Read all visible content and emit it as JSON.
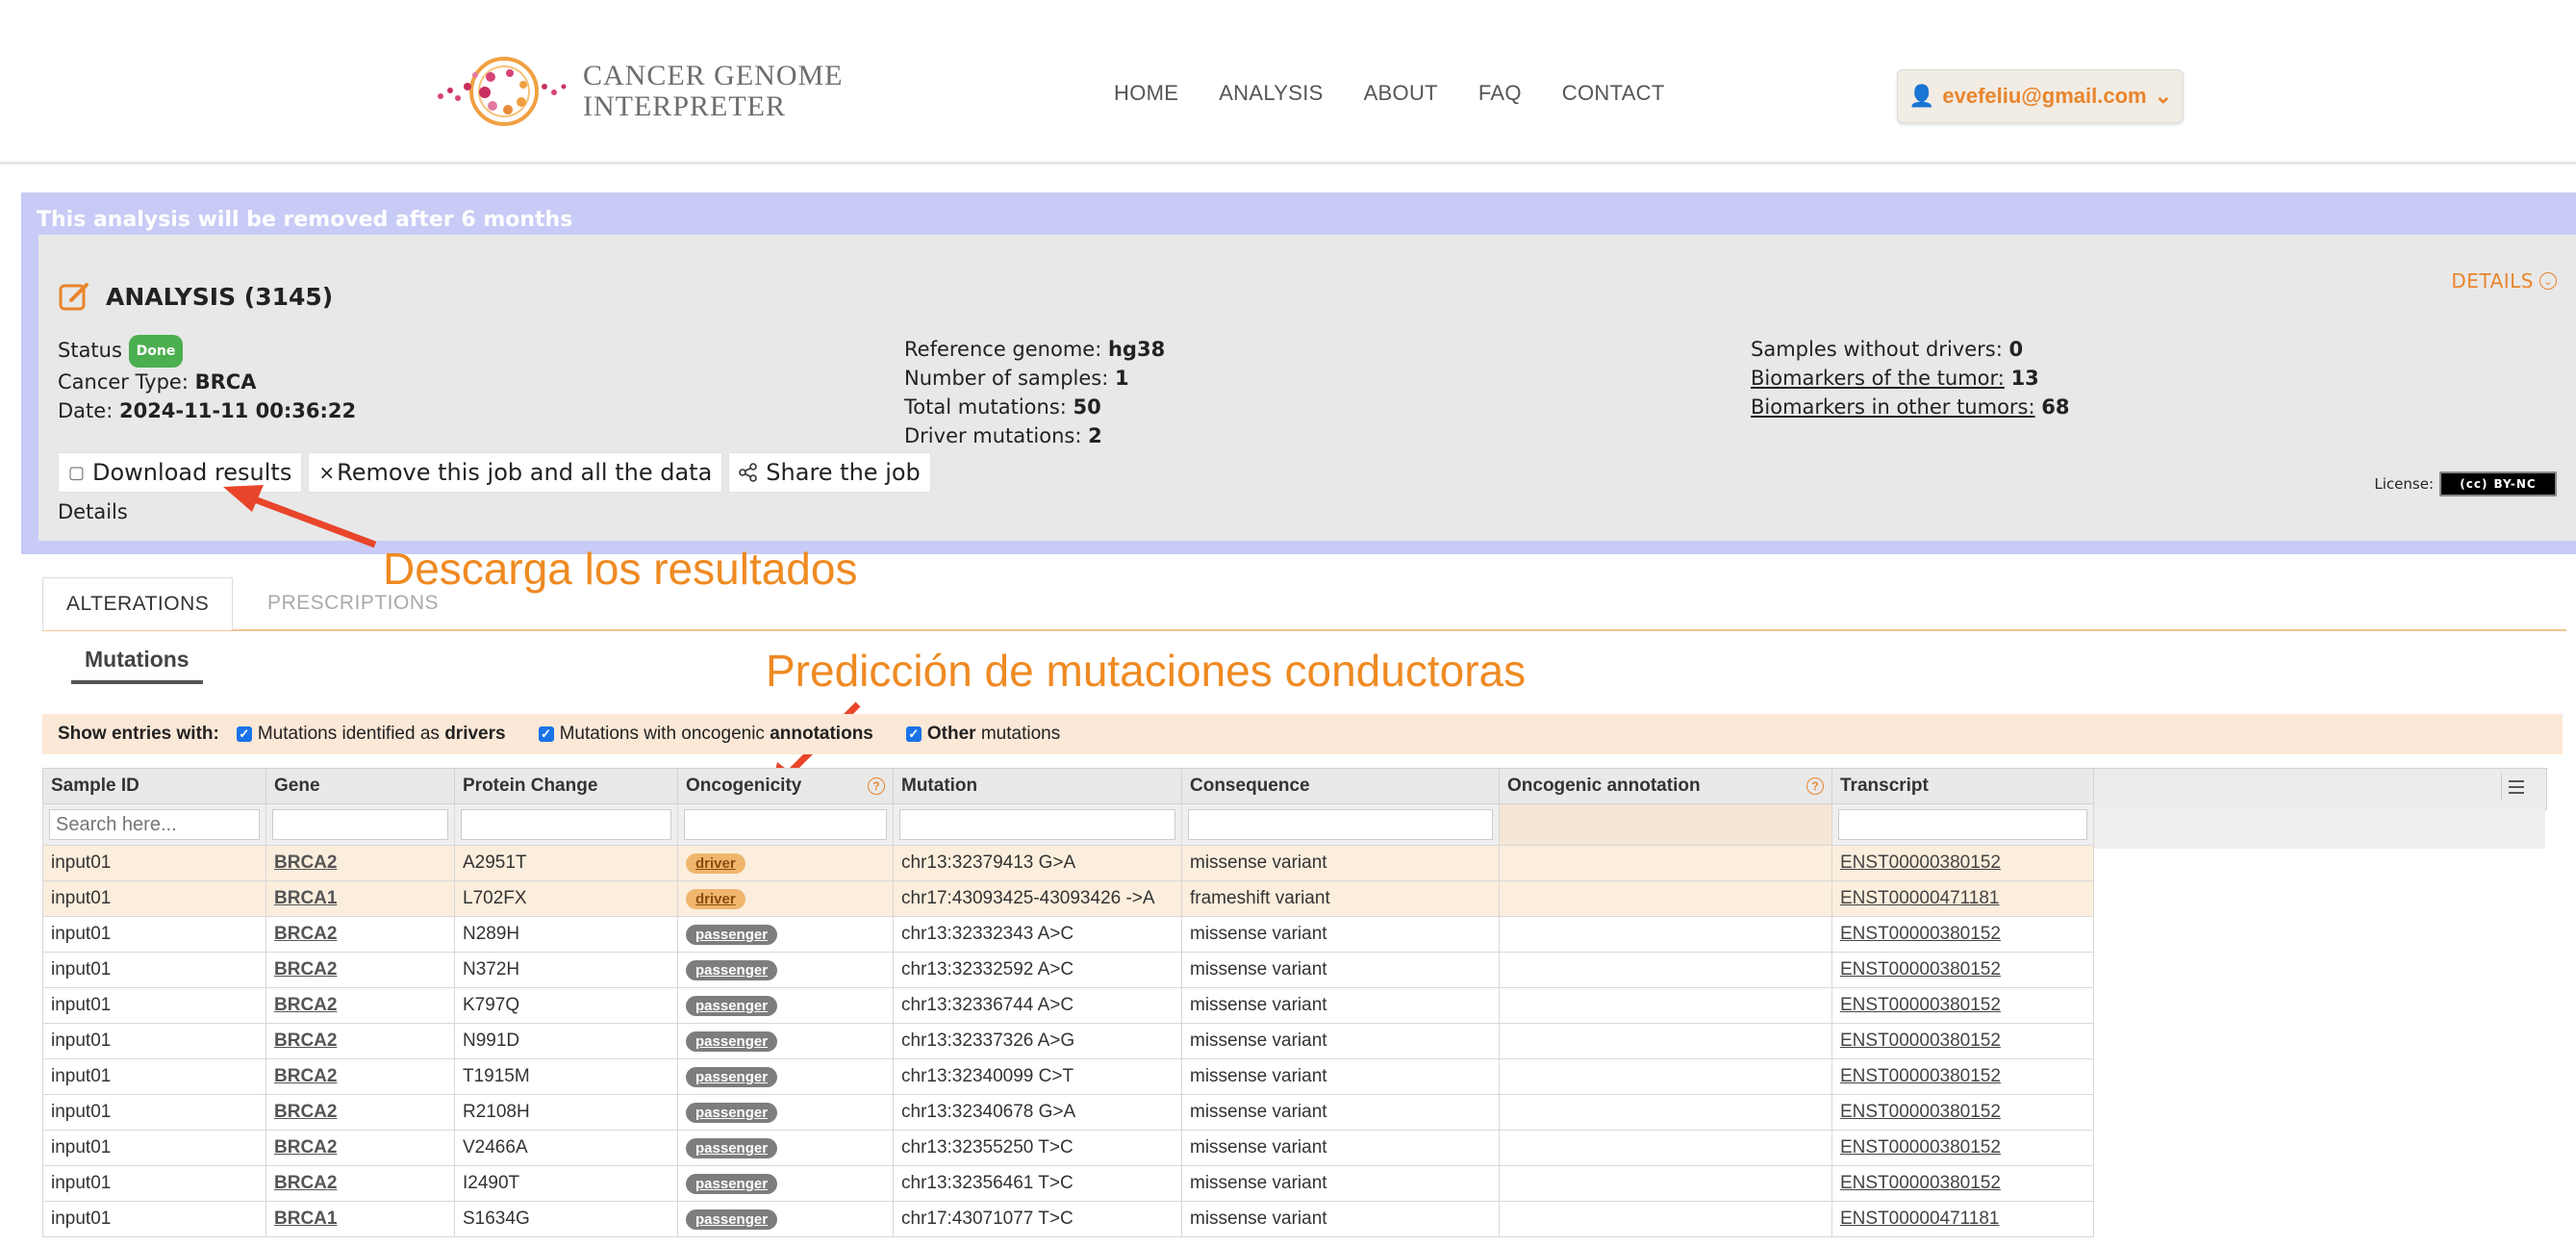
{
  "header": {
    "logo_line1": "CANCER GENOME",
    "logo_line2": "INTERPRETER",
    "nav": [
      "HOME",
      "ANALYSIS",
      "ABOUT",
      "FAQ",
      "CONTACT"
    ],
    "user_email": "evefeliu@gmail.com"
  },
  "banner": {
    "notice": "This analysis will be removed after 6 months",
    "title": "ANALYSIS (3145)",
    "details_link": "DETAILS",
    "status_label": "Status",
    "status_value": "Done",
    "cancer_type_label": "Cancer Type:",
    "cancer_type_value": "BRCA",
    "date_label": "Date:",
    "date_value": "2024-11-11 00:36:22",
    "ref_genome_label": "Reference genome:",
    "ref_genome_value": "hg38",
    "num_samples_label": "Number of samples:",
    "num_samples_value": "1",
    "total_mut_label": "Total mutations:",
    "total_mut_value": "50",
    "driver_mut_label": "Driver mutations:",
    "driver_mut_value": "2",
    "samples_wo_drivers_label": "Samples without drivers:",
    "samples_wo_drivers_value": "0",
    "biomarkers_tumor_label": "Biomarkers of the tumor:",
    "biomarkers_tumor_value": "13",
    "biomarkers_other_label": "Biomarkers in other tumors:",
    "biomarkers_other_value": "68",
    "download_btn": "Download results",
    "remove_btn": "Remove this job and all the data",
    "share_btn": "Share the job",
    "details": "Details",
    "license_label": "License:",
    "license_badge": "BY-NC"
  },
  "annotations": {
    "download_note": "Descarga los resultados",
    "prediction_note": "Predicción de mutaciones conductoras"
  },
  "tabs": [
    "ALTERATIONS",
    "PRESCRIPTIONS"
  ],
  "subtab": "Mutations",
  "filter": {
    "label": "Show entries with:",
    "opt1_pre": "Mutations identified as ",
    "opt1_bold": "drivers",
    "opt2_pre": "Mutations with oncogenic ",
    "opt2_bold": "annotations",
    "opt3_bold": "Other",
    "opt3_post": " mutations"
  },
  "table": {
    "columns": [
      "Sample ID",
      "Gene",
      "Protein Change",
      "Oncogenicity",
      "Mutation",
      "Consequence",
      "Oncogenic annotation",
      "Transcript"
    ],
    "search_placeholder": "Search here...",
    "rows": [
      {
        "sample": "input01",
        "gene": "BRCA2",
        "protein": "A2951T",
        "onco": "driver",
        "mutation": "chr13:32379413 G>A",
        "consequence": "missense variant",
        "transcript": "ENST00000380152"
      },
      {
        "sample": "input01",
        "gene": "BRCA1",
        "protein": "L702FX",
        "onco": "driver",
        "mutation": "chr17:43093425-43093426 ->A",
        "consequence": "frameshift variant",
        "transcript": "ENST00000471181"
      },
      {
        "sample": "input01",
        "gene": "BRCA2",
        "protein": "N289H",
        "onco": "passenger",
        "mutation": "chr13:32332343 A>C",
        "consequence": "missense variant",
        "transcript": "ENST00000380152"
      },
      {
        "sample": "input01",
        "gene": "BRCA2",
        "protein": "N372H",
        "onco": "passenger",
        "mutation": "chr13:32332592 A>C",
        "consequence": "missense variant",
        "transcript": "ENST00000380152"
      },
      {
        "sample": "input01",
        "gene": "BRCA2",
        "protein": "K797Q",
        "onco": "passenger",
        "mutation": "chr13:32336744 A>C",
        "consequence": "missense variant",
        "transcript": "ENST00000380152"
      },
      {
        "sample": "input01",
        "gene": "BRCA2",
        "protein": "N991D",
        "onco": "passenger",
        "mutation": "chr13:32337326 A>G",
        "consequence": "missense variant",
        "transcript": "ENST00000380152"
      },
      {
        "sample": "input01",
        "gene": "BRCA2",
        "protein": "T1915M",
        "onco": "passenger",
        "mutation": "chr13:32340099 C>T",
        "consequence": "missense variant",
        "transcript": "ENST00000380152"
      },
      {
        "sample": "input01",
        "gene": "BRCA2",
        "protein": "R2108H",
        "onco": "passenger",
        "mutation": "chr13:32340678 G>A",
        "consequence": "missense variant",
        "transcript": "ENST00000380152"
      },
      {
        "sample": "input01",
        "gene": "BRCA2",
        "protein": "V2466A",
        "onco": "passenger",
        "mutation": "chr13:32355250 T>C",
        "consequence": "missense variant",
        "transcript": "ENST00000380152"
      },
      {
        "sample": "input01",
        "gene": "BRCA2",
        "protein": "I2490T",
        "onco": "passenger",
        "mutation": "chr13:32356461 T>C",
        "consequence": "missense variant",
        "transcript": "ENST00000380152"
      },
      {
        "sample": "input01",
        "gene": "BRCA1",
        "protein": "S1634G",
        "onco": "passenger",
        "mutation": "chr17:43071077 T>C",
        "consequence": "missense variant",
        "transcript": "ENST00000471181"
      }
    ]
  },
  "colors": {
    "accent": "#e8852d",
    "banner": "#c8cbf5",
    "driver_row": "#fbeedd"
  }
}
